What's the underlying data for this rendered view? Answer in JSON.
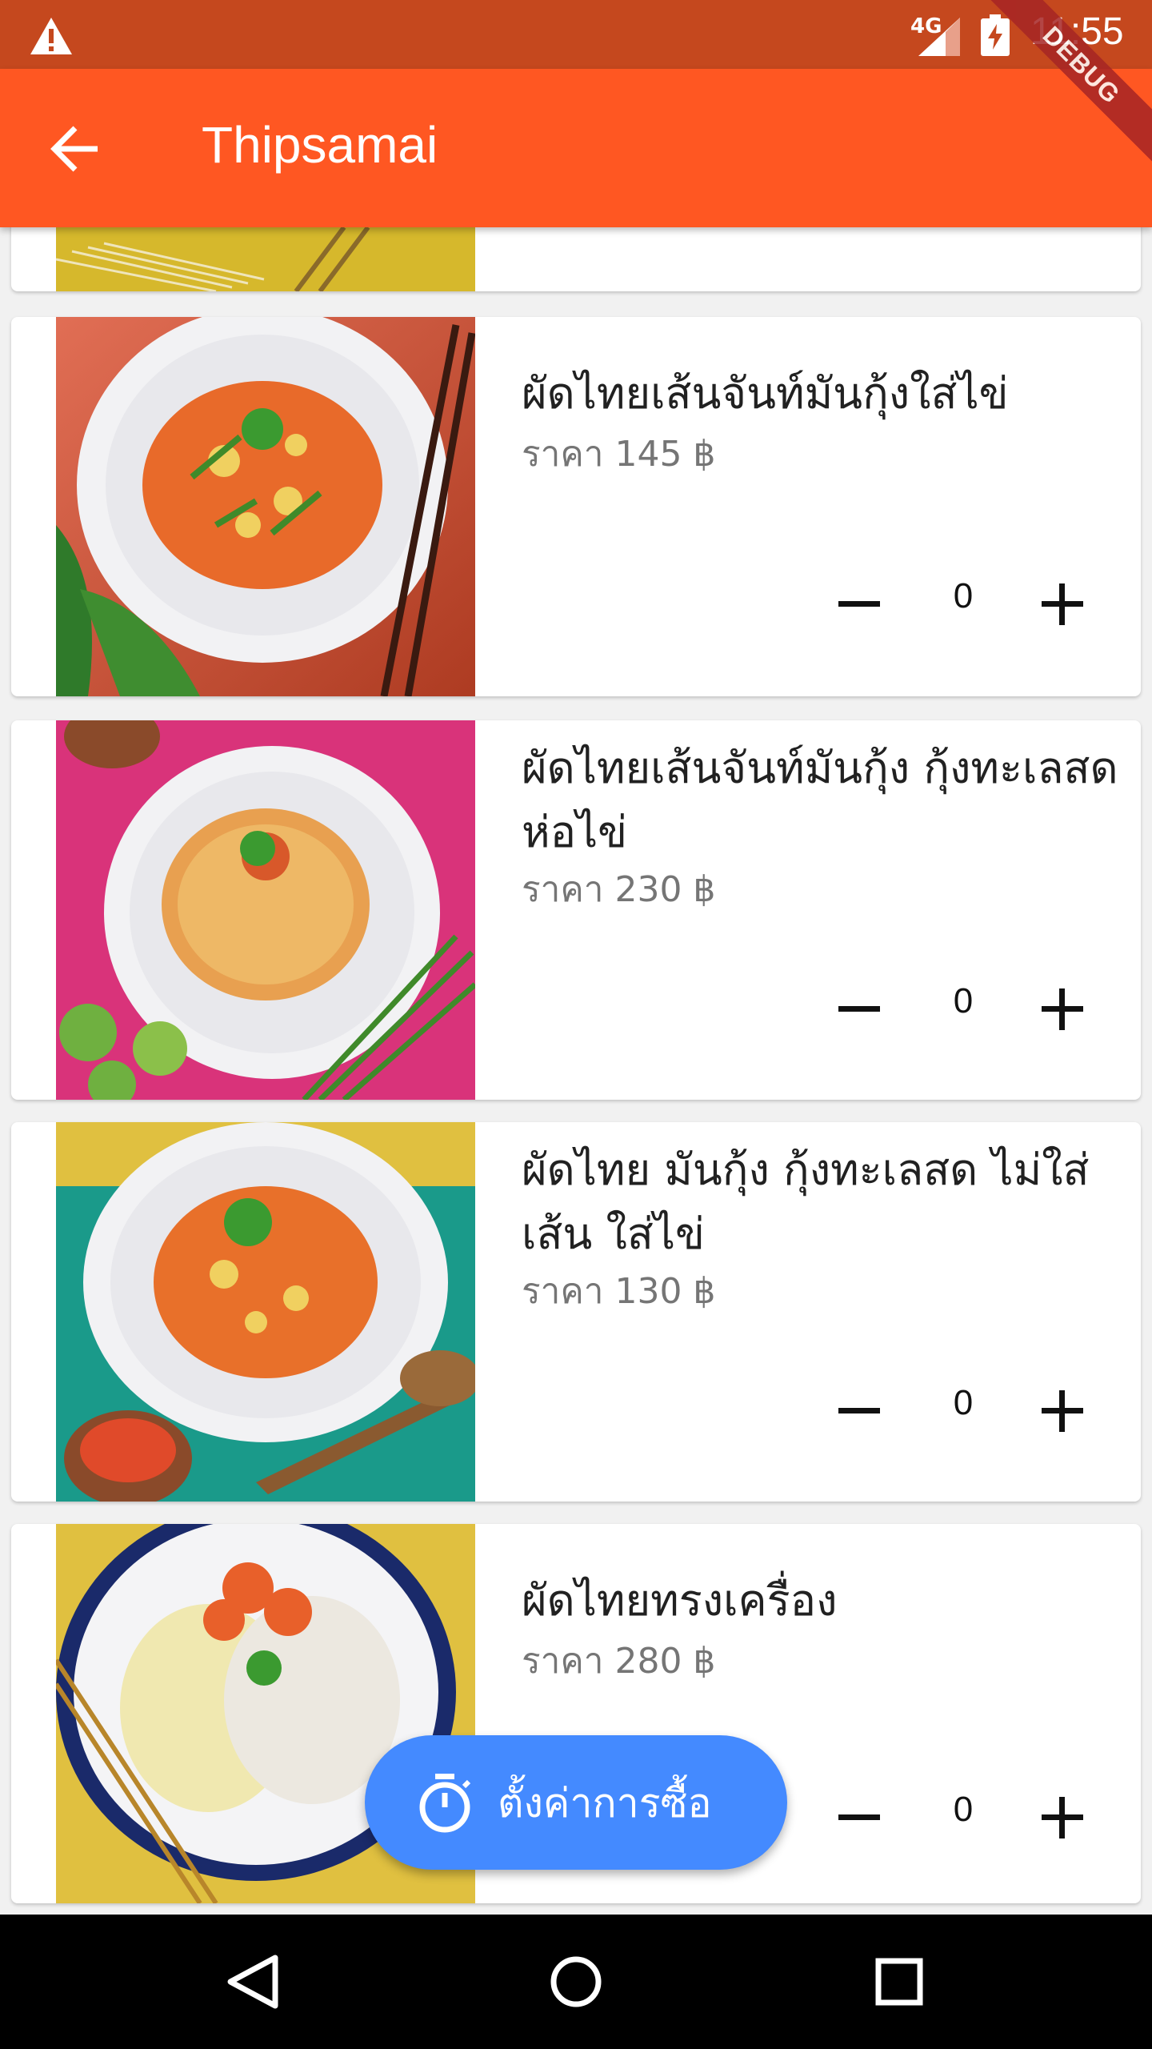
{
  "status_bar": {
    "network": "4G",
    "time": "11:55"
  },
  "debug_banner": "DEBUG",
  "app_bar": {
    "title": "Thipsamai"
  },
  "menu": {
    "items": [
      {
        "name": "ผัดไทยเส้นจันท์มันกุ้งใส่ไข่",
        "price": "ราคา 145 ฿",
        "qty": "0"
      },
      {
        "name": "ผัดไทยเส้นจันท์มันกุ้ง กุ้งทะเลสดห่อไข่",
        "price": "ราคา 230 ฿",
        "qty": "0"
      },
      {
        "name": "ผัดไทย มันกุ้ง กุ้งทะเลสด ไม่ใส่เส้น ใส่ไข่",
        "price": "ราคา 130 ฿",
        "qty": "0"
      },
      {
        "name": "ผัดไทยทรงเครื่อง",
        "price": "ราคา 280 ฿",
        "qty": "0"
      }
    ]
  },
  "fab": {
    "label": "ตั้งค่าการซื้อ",
    "icon": "timer-icon"
  },
  "colors": {
    "status_bar": "#c5481e",
    "app_bar": "#ff5722",
    "fab": "#448aff"
  }
}
